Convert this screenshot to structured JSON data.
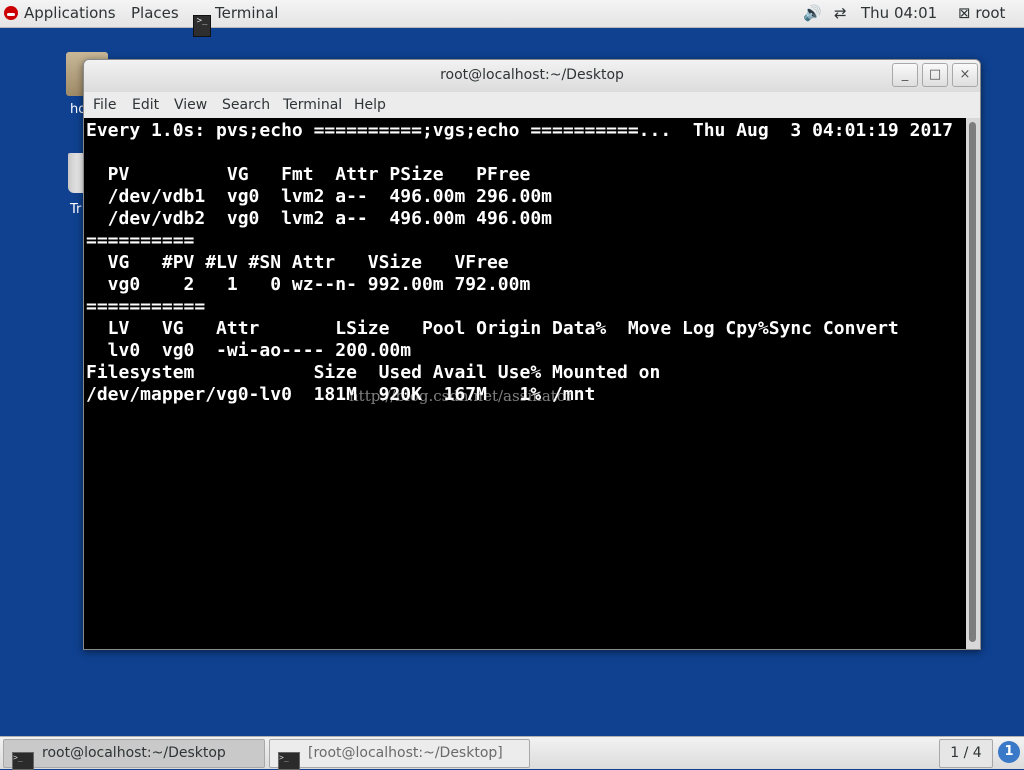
{
  "top_panel": {
    "applications": "Applications",
    "places": "Places",
    "active_app": "Terminal",
    "clock": "Thu 04:01",
    "user": "root",
    "icons": {
      "volume": "volume-icon",
      "network": "network-icon",
      "user": "user-icon"
    }
  },
  "desktop": {
    "home_label": "ho",
    "trash_label": "Tr"
  },
  "window": {
    "title": "root@localhost:~/Desktop",
    "controls": {
      "minimize": "_",
      "maximize": "□",
      "close": "×"
    },
    "menu": [
      "File",
      "Edit",
      "View",
      "Search",
      "Terminal",
      "Help"
    ]
  },
  "terminal": {
    "lines": [
      "Every 1.0s: pvs;echo ==========;vgs;echo ==========...  Thu Aug  3 04:01:19 2017",
      "",
      "  PV         VG   Fmt  Attr PSize   PFree",
      "  /dev/vdb1  vg0  lvm2 a--  496.00m 296.00m",
      "  /dev/vdb2  vg0  lvm2 a--  496.00m 496.00m",
      "==========",
      "  VG   #PV #LV #SN Attr   VSize   VFree",
      "  vg0    2   1   0 wz--n- 992.00m 792.00m",
      "===========",
      "  LV   VG   Attr       LSize   Pool Origin Data%  Move Log Cpy%Sync Convert",
      "  lv0  vg0  -wi-ao---- 200.00m",
      "Filesystem           Size  Used Avail Use% Mounted on",
      "/dev/mapper/vg0-lv0  181M  920K  167M   1% /mnt"
    ],
    "watermark": "http://blog.csdn.net/assinator"
  },
  "bottom_panel": {
    "tasks": [
      "root@localhost:~/Desktop",
      "[root@localhost:~/Desktop]"
    ],
    "workspace": "1 / 4",
    "info_icon": "1"
  },
  "colors": {
    "desktop": "#0f4190",
    "terminal_bg": "#000000",
    "terminal_fg": "#ffffff"
  }
}
